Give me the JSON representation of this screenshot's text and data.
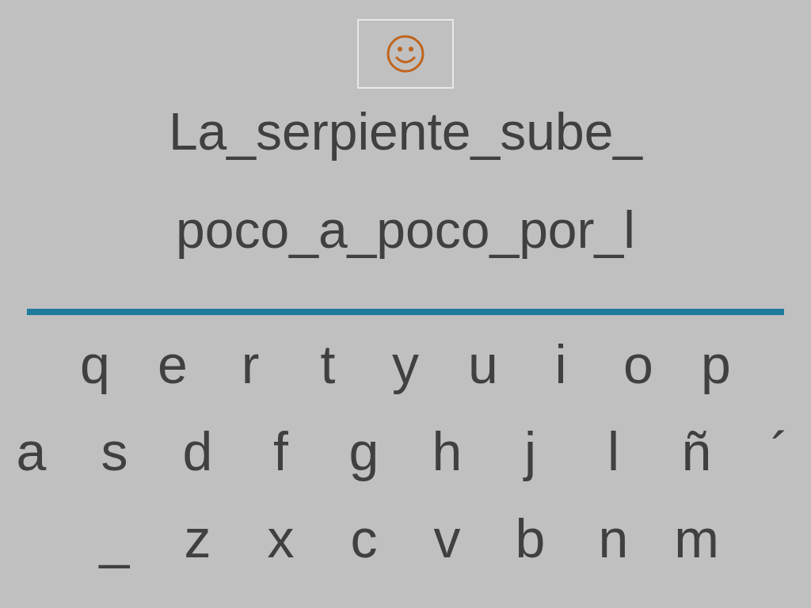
{
  "sentence_lines": [
    "La_serpiente_sube_",
    "poco_a_poco_por_l"
  ],
  "keyboard_rows": [
    [
      "q",
      "e",
      "r",
      "t",
      "y",
      "u",
      "i",
      "o",
      "p"
    ],
    [
      "a",
      "s",
      "d",
      "f",
      "g",
      "h",
      "j",
      "l",
      "ñ",
      "´"
    ],
    [
      "_",
      "z",
      "x",
      "c",
      "v",
      "b",
      "n",
      "m"
    ]
  ]
}
